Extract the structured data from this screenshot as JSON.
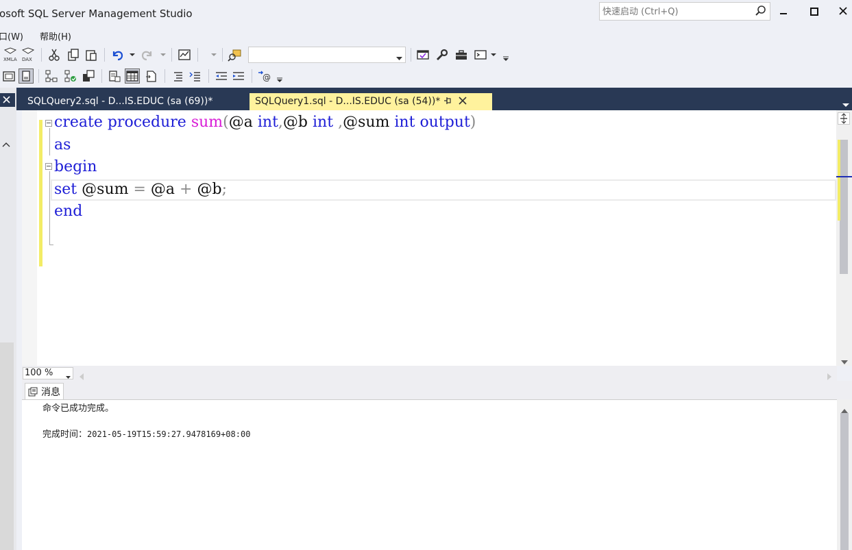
{
  "window": {
    "title": "osoft SQL Server Management Studio",
    "quick_launch_placeholder": "快速启动 (Ctrl+Q)"
  },
  "menu": {
    "items": [
      {
        "label": "口(W)"
      },
      {
        "label": "帮助(H)"
      }
    ]
  },
  "toolbar1": {
    "icons": [
      "xmla-icon",
      "dax-icon",
      "cut-icon",
      "copy-icon",
      "paste-icon",
      "undo-icon",
      "redo-icon",
      "activity-monitor-icon",
      "find-icon",
      "vs-icon",
      "wrench-icon",
      "toolbox-icon",
      "console-icon"
    ],
    "combo_value": ""
  },
  "toolbar2": {
    "icons": [
      "results-text-icon",
      "results-file-icon",
      "show-plan-icon",
      "query-stats-icon",
      "client-stats-icon",
      "results-to-text-icon",
      "results-to-grid-icon",
      "results-to-file-icon",
      "comment-icon",
      "uncomment-icon",
      "decrease-indent-icon",
      "increase-indent-icon",
      "specify-values-icon"
    ]
  },
  "tabs": [
    {
      "label": "SQLQuery2.sql - D...IS.EDUC (sa (69))*",
      "active": false
    },
    {
      "label": "SQLQuery1.sql - D...IS.EDUC (sa (54))*",
      "active": true
    }
  ],
  "editor": {
    "lines": [
      {
        "tokens": [
          [
            "kw",
            "create"
          ],
          [
            "sp",
            " "
          ],
          [
            "kw",
            "procedure"
          ],
          [
            "sp",
            " "
          ],
          [
            "fn",
            "sum"
          ],
          [
            "op",
            "("
          ],
          [
            "var",
            "@a"
          ],
          [
            "sp",
            " "
          ],
          [
            "kw",
            "int"
          ],
          [
            "op",
            ","
          ],
          [
            "var",
            "@b"
          ],
          [
            "sp",
            " "
          ],
          [
            "kw",
            "int"
          ],
          [
            "sp",
            " "
          ],
          [
            "op",
            ","
          ],
          [
            "var",
            "@sum"
          ],
          [
            "sp",
            " "
          ],
          [
            "kw",
            "int"
          ],
          [
            "sp",
            " "
          ],
          [
            "kw",
            "output"
          ],
          [
            "op",
            ")"
          ]
        ]
      },
      {
        "tokens": [
          [
            "kw",
            "as"
          ]
        ]
      },
      {
        "tokens": [
          [
            "kw",
            "begin"
          ]
        ]
      },
      {
        "tokens": [
          [
            "kw",
            "set"
          ],
          [
            "sp",
            " "
          ],
          [
            "var",
            "@sum"
          ],
          [
            "sp",
            " "
          ],
          [
            "op",
            "="
          ],
          [
            "sp",
            " "
          ],
          [
            "var",
            "@a"
          ],
          [
            "sp",
            " "
          ],
          [
            "op",
            "+"
          ],
          [
            "sp",
            " "
          ],
          [
            "var",
            "@b"
          ],
          [
            "op",
            ";"
          ]
        ]
      },
      {
        "tokens": [
          [
            "kw",
            "end"
          ]
        ]
      }
    ]
  },
  "zoom": {
    "value": "100 %"
  },
  "results": {
    "tab_label": "消息",
    "message": "命令已成功完成。",
    "completion_label": "完成时间：",
    "completion_time": "2021-05-19T15:59:27.9478169+08:00"
  },
  "colors": {
    "keyword": "#1d1dd6",
    "function": "#d81bd6",
    "active_tab": "#fff29d",
    "tab_bar": "#293955"
  }
}
